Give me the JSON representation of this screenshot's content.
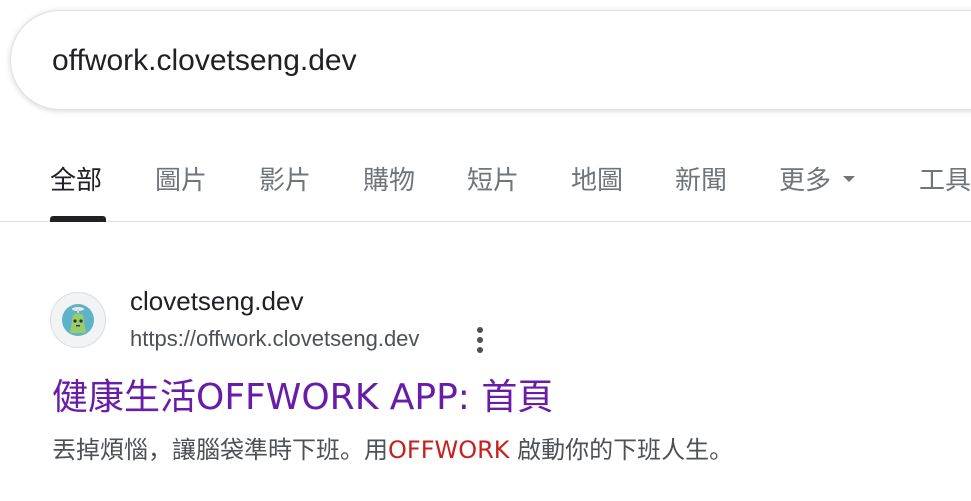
{
  "search": {
    "query": "offwork.clovetseng.dev"
  },
  "tabs": [
    {
      "label": "全部",
      "active": true
    },
    {
      "label": "圖片"
    },
    {
      "label": "影片"
    },
    {
      "label": "購物"
    },
    {
      "label": "短片"
    },
    {
      "label": "地圖"
    },
    {
      "label": "新聞"
    },
    {
      "label": "更多"
    },
    {
      "label": "工具"
    }
  ],
  "result": {
    "site_name": "clovetseng.dev",
    "url": "https://offwork.clovetseng.dev",
    "title": "健康生活OFFWORK APP: 首頁",
    "snippet_before": "丟掉煩惱，讓腦袋準時下班。用",
    "snippet_highlight": "OFFWORK",
    "snippet_after": " 啟動你的下班人生。",
    "favicon_icon": "green-mascot-icon"
  },
  "colors": {
    "visited_link": "#681da8",
    "highlight": "#c5221f"
  }
}
